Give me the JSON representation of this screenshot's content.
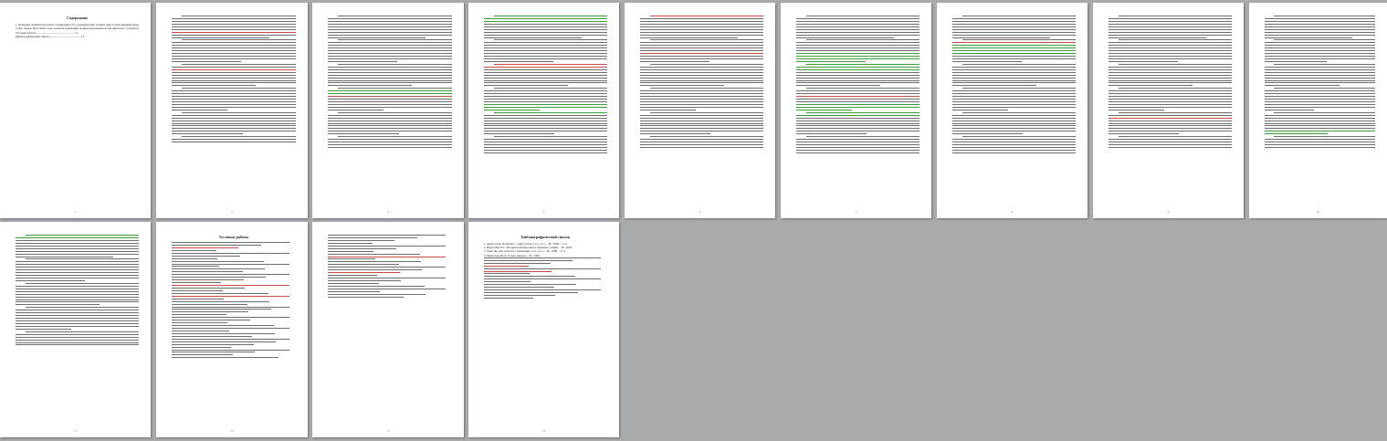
{
  "document": {
    "pages_total": 13
  },
  "pages": [
    {
      "id": "1",
      "title": "Содержание",
      "toc": [
        "1. Правовые понятия категории «справедливость» в юридических теориях Аристотеля (Древняя Греция и Древний Рим)",
        "2. Дж. Локк и Ш.Л. Монтескье: развитие концепции теории разделения властей (правового государства) и теории государственной власти......3",
        "Тестовые работы.......................................................11",
        "Библиографический список..............................................13"
      ],
      "number": "2"
    },
    {
      "id": "2",
      "title": "",
      "number": "3"
    },
    {
      "id": "3",
      "title": "",
      "number": "4"
    },
    {
      "id": "4",
      "title": "",
      "number": "5"
    },
    {
      "id": "5",
      "title": "",
      "number": "6"
    },
    {
      "id": "6",
      "title": "",
      "number": "7"
    },
    {
      "id": "7",
      "title": "",
      "number": "8"
    },
    {
      "id": "8",
      "title": "",
      "number": "9"
    },
    {
      "id": "9",
      "title": "",
      "number": "10"
    },
    {
      "id": "10",
      "title": "",
      "number": "11"
    },
    {
      "id": "11",
      "title": "Тестовые работы",
      "number": "12"
    },
    {
      "id": "12",
      "title": "",
      "number": "13"
    },
    {
      "id": "13",
      "title": "Библиографический список",
      "bibliography": [
        "1. Аристотель. Политика. // Аристотель. Соч.: в 4 т. – М., 1983. – Т. 4.",
        "2. Нерсесянц В.С. История политических и правовых учений. – М., 2004.",
        "3. Локк Дж. Два трактата о правлении. Соч.: в 3 т. – М., 1988. – Т. 3.",
        "4. Монтескье Ш.Л. О духе законов. – М., 1999."
      ],
      "number": "14"
    }
  ]
}
